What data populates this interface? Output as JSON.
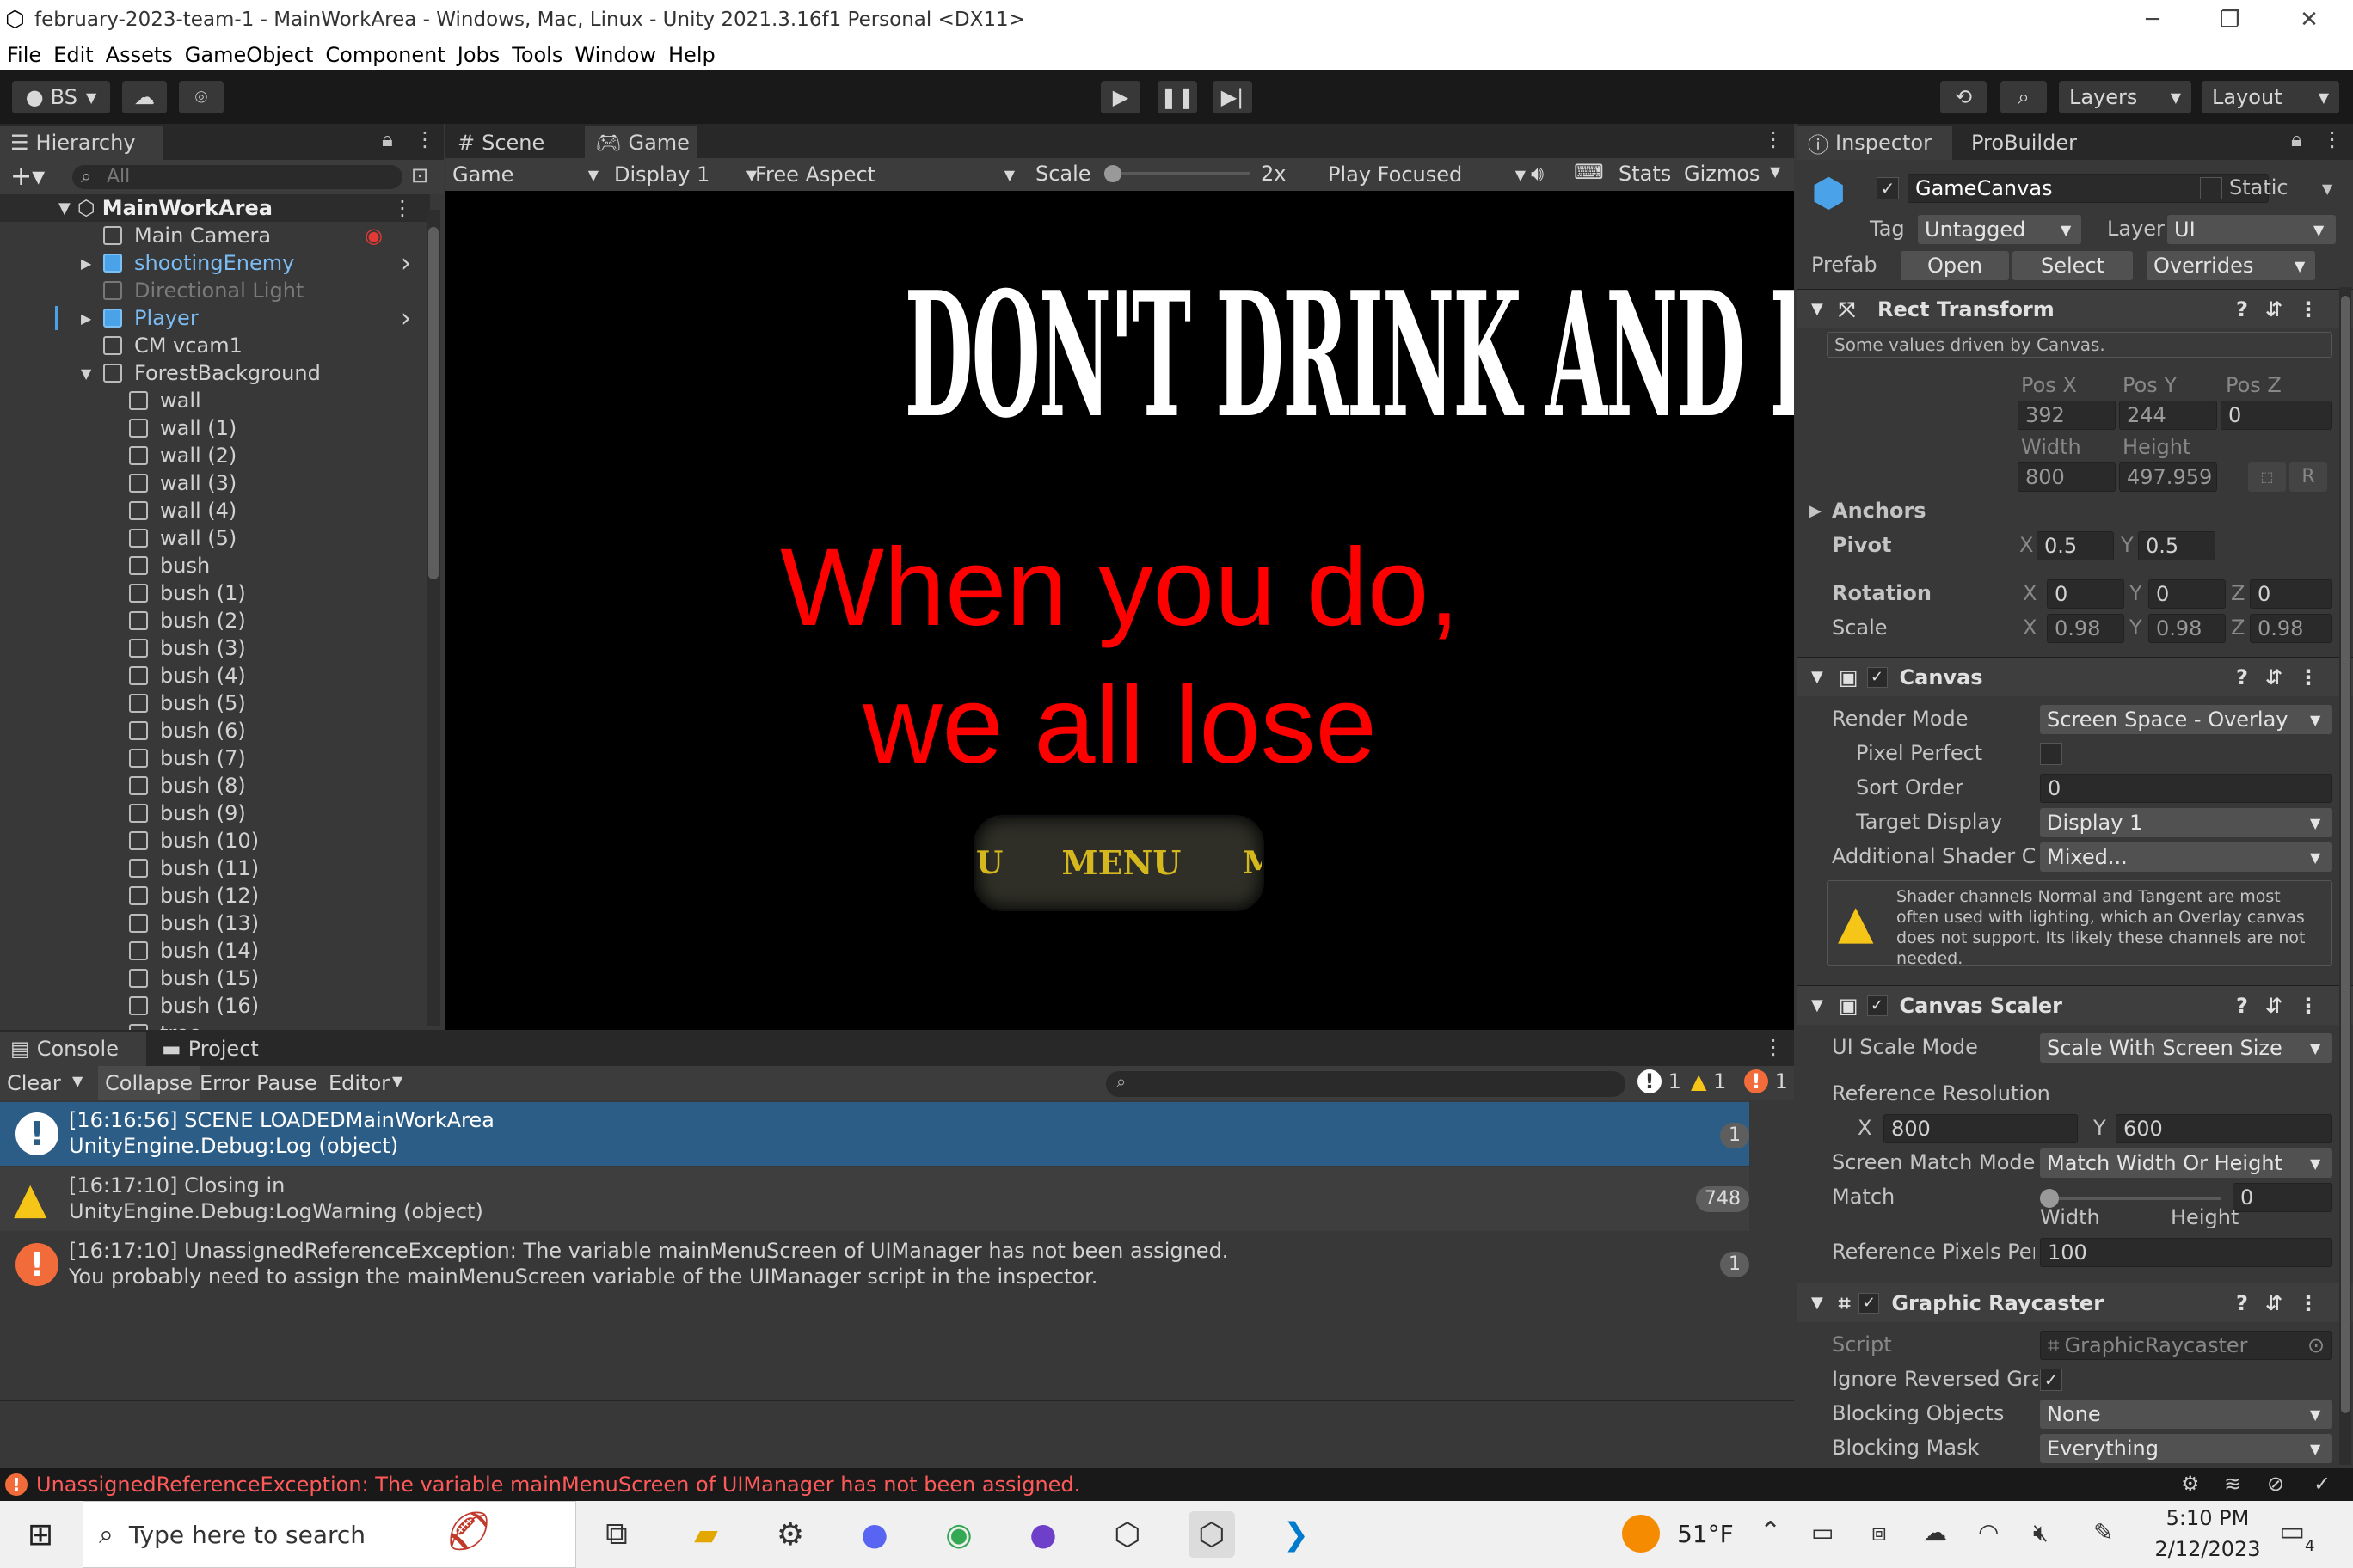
{
  "window": {
    "title": "february-2023-team-1 - MainWorkArea - Windows, Mac, Linux - Unity 2021.3.16f1 Personal <DX11>"
  },
  "menu": [
    "File",
    "Edit",
    "Assets",
    "GameObject",
    "Component",
    "Jobs",
    "Tools",
    "Window",
    "Help"
  ],
  "toolbar": {
    "account": "BS",
    "layers": "Layers",
    "layout": "Layout"
  },
  "hierarchy": {
    "tab": "Hierarchy",
    "search_placeholder": "All",
    "scene": "MainWorkArea",
    "items": [
      {
        "label": "Main Camera",
        "indent": 1,
        "type": "normal",
        "arrow": false
      },
      {
        "label": "shootingEnemy",
        "indent": 1,
        "type": "prefab",
        "arrow": true
      },
      {
        "label": "Directional Light",
        "indent": 1,
        "type": "disabled",
        "arrow": false
      },
      {
        "label": "Player",
        "indent": 1,
        "type": "prefab",
        "arrow": true
      },
      {
        "label": "CM vcam1",
        "indent": 1,
        "type": "normal",
        "arrow": false
      },
      {
        "label": "ForestBackground",
        "indent": 1,
        "type": "normal",
        "arrow": true
      },
      {
        "label": "wall",
        "indent": 2,
        "type": "normal"
      },
      {
        "label": "wall (1)",
        "indent": 2,
        "type": "normal"
      },
      {
        "label": "wall (2)",
        "indent": 2,
        "type": "normal"
      },
      {
        "label": "wall (3)",
        "indent": 2,
        "type": "normal"
      },
      {
        "label": "wall (4)",
        "indent": 2,
        "type": "normal"
      },
      {
        "label": "wall (5)",
        "indent": 2,
        "type": "normal"
      },
      {
        "label": "bush",
        "indent": 2,
        "type": "normal"
      },
      {
        "label": "bush (1)",
        "indent": 2,
        "type": "normal"
      },
      {
        "label": "bush (2)",
        "indent": 2,
        "type": "normal"
      },
      {
        "label": "bush (3)",
        "indent": 2,
        "type": "normal"
      },
      {
        "label": "bush (4)",
        "indent": 2,
        "type": "normal"
      },
      {
        "label": "bush (5)",
        "indent": 2,
        "type": "normal"
      },
      {
        "label": "bush (6)",
        "indent": 2,
        "type": "normal"
      },
      {
        "label": "bush (7)",
        "indent": 2,
        "type": "normal"
      },
      {
        "label": "bush (8)",
        "indent": 2,
        "type": "normal"
      },
      {
        "label": "bush (9)",
        "indent": 2,
        "type": "normal"
      },
      {
        "label": "bush (10)",
        "indent": 2,
        "type": "normal"
      },
      {
        "label": "bush (11)",
        "indent": 2,
        "type": "normal"
      },
      {
        "label": "bush (12)",
        "indent": 2,
        "type": "normal"
      },
      {
        "label": "bush (13)",
        "indent": 2,
        "type": "normal"
      },
      {
        "label": "bush (14)",
        "indent": 2,
        "type": "normal"
      },
      {
        "label": "bush (15)",
        "indent": 2,
        "type": "normal"
      },
      {
        "label": "bush (16)",
        "indent": 2,
        "type": "normal"
      },
      {
        "label": "tree",
        "indent": 2,
        "type": "normal"
      }
    ]
  },
  "game": {
    "tabs": {
      "scene": "Scene",
      "game": "Game"
    },
    "bar": {
      "mode": "Game",
      "display": "Display 1",
      "aspect": "Free Aspect",
      "scale_label": "Scale",
      "scale_value": "2x",
      "play": "Play Focused",
      "stats": "Stats",
      "gizmos": "Gizmos"
    },
    "headline": "DON'T DRINK AND DRIVE",
    "line1": "When you do,",
    "line2": "we all lose",
    "button": "MENU",
    "button_left": "U",
    "button_right": "M"
  },
  "console": {
    "tabs": {
      "console": "Console",
      "project": "Project"
    },
    "bar": {
      "clear": "Clear",
      "collapse": "Collapse",
      "error_pause": "Error Pause",
      "editor": "Editor",
      "info_count": "1",
      "warn_count": "1",
      "error_count": "1"
    },
    "entries": [
      {
        "type": "info",
        "line1": "[16:16:56] SCENE LOADEDMainWorkArea",
        "line2": "UnityEngine.Debug:Log (object)",
        "count": "1"
      },
      {
        "type": "warning",
        "line1": "[16:17:10] Closing in",
        "line2": "UnityEngine.Debug:LogWarning (object)",
        "count": "748"
      },
      {
        "type": "error",
        "line1": "[16:17:10] UnassignedReferenceException: The variable mainMenuScreen of UIManager has not been assigned.",
        "line2": "You probably need to assign the mainMenuScreen variable of the UIManager script in the inspector.",
        "count": "1"
      }
    ]
  },
  "inspector": {
    "tabs": {
      "inspector": "Inspector",
      "probuilder": "ProBuilder"
    },
    "object_name": "GameCanvas",
    "static_label": "Static",
    "tag_label": "Tag",
    "tag_value": "Untagged",
    "layer_label": "Layer",
    "layer_value": "UI",
    "prefab_label": "Prefab",
    "prefab_open": "Open",
    "prefab_select": "Select",
    "prefab_overrides": "Overrides",
    "rect": {
      "title": "Rect Transform",
      "note": "Some values driven by Canvas.",
      "posx_label": "Pos X",
      "posy_label": "Pos Y",
      "posz_label": "Pos Z",
      "posx": "392",
      "posy": "244",
      "posz": "0",
      "width_label": "Width",
      "height_label": "Height",
      "width": "800",
      "height": "497.959",
      "r": "R",
      "anchors": "Anchors",
      "pivot": "Pivot",
      "pivot_x": "0.5",
      "pivot_y": "0.5",
      "rotation": "Rotation",
      "rot_x": "0",
      "rot_y": "0",
      "rot_z": "0",
      "scale": "Scale",
      "scale_x": "0.98",
      "scale_y": "0.98",
      "scale_z": "0.98",
      "x": "X",
      "y": "Y",
      "z": "Z"
    },
    "canvas": {
      "title": "Canvas",
      "render_mode_label": "Render Mode",
      "render_mode": "Screen Space - Overlay",
      "pixel_perfect": "Pixel Perfect",
      "sort_order_label": "Sort Order",
      "sort_order": "0",
      "target_display_label": "Target Display",
      "target_display": "Display 1",
      "shader_label": "Additional Shader Ch",
      "shader_value": "Mixed...",
      "warning": "Shader channels Normal and Tangent are most often used with lighting, which an Overlay canvas does not support. Its likely these channels are not needed."
    },
    "scaler": {
      "title": "Canvas Scaler",
      "mode_label": "UI Scale Mode",
      "mode": "Scale With Screen Size",
      "ref_res_label": "Reference Resolution",
      "ref_x": "800",
      "ref_y": "600",
      "match_mode_label": "Screen Match Mode",
      "match_mode": "Match Width Or Height",
      "match_label": "Match",
      "match_value": "0",
      "match_fraction": 0,
      "width": "Width",
      "height": "Height",
      "ppu_label": "Reference Pixels Per",
      "ppu": "100"
    },
    "raycaster": {
      "title": "Graphic Raycaster",
      "script_label": "Script",
      "script": "GraphicRaycaster",
      "ignore_label": "Ignore Reversed Grap",
      "blocking_label": "Blocking Objects",
      "blocking": "None",
      "mask_label": "Blocking Mask",
      "mask": "Everything"
    }
  },
  "status": {
    "message": "UnassignedReferenceException: The variable mainMenuScreen of UIManager has not been assigned."
  },
  "taskbar": {
    "search": "Type here to search",
    "weather": "51°F",
    "time": "5:10 PM",
    "date": "2/12/2023",
    "notifications": "4"
  }
}
